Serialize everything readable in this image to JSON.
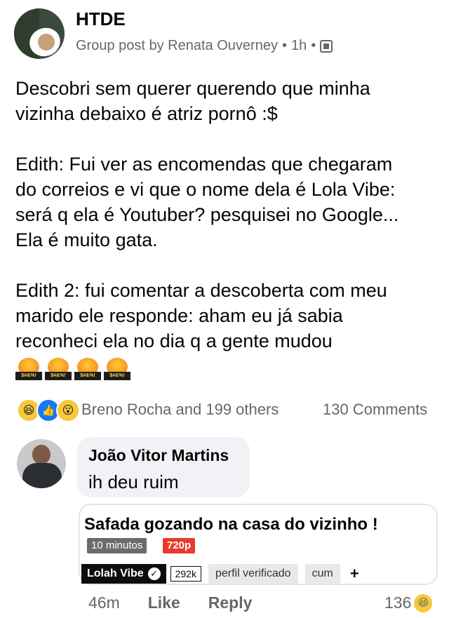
{
  "header": {
    "group_name": "HTDE",
    "meta": "Group post by Renata Ouverney",
    "time": "1h",
    "separator": "•"
  },
  "post": {
    "text": "Descobri sem querer querendo que minha\nvizinha debaixo é atriz pornô :$\n\nEdith: Fui ver as encomendas que chegaram\ndo correios e vi que o nome dela é Lola Vibe:\nserá q ela é Youtuber? pesquisei no Google...\nEla é muito gata.\n\nEdith 2: fui comentar a descoberta com meu\nmarido ele responde: aham eu já sabia\nreconheci ela no dia q a gente mudou",
    "emoji_label": "$#&%!",
    "emoji_count": 4
  },
  "reactions": {
    "names": "Breno Rocha and 199 others",
    "comments": "130 Comments",
    "icons": [
      "haha-icon",
      "like-icon",
      "wow-icon"
    ]
  },
  "comment": {
    "author": "João Vitor Martins",
    "text": "ih deu ruim",
    "card": {
      "title": "Safada gozando na casa do vizinho !",
      "duration": "10 minutos",
      "quality": "720p",
      "channel": "Lolah Vibe",
      "subscribers": "292k",
      "chip_verified": "perfil verificado",
      "chip_tag": "cum",
      "add": "+"
    },
    "actions": {
      "time": "46m",
      "like": "Like",
      "reply": "Reply"
    },
    "reaction_count": "136"
  }
}
